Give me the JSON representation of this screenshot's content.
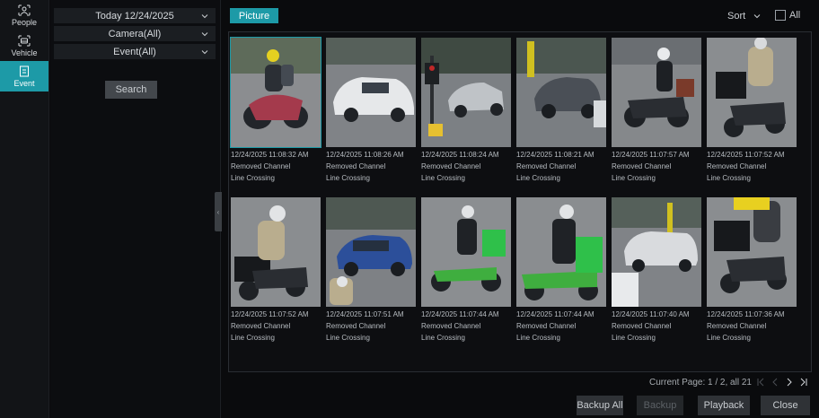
{
  "sidebar": {
    "items": [
      {
        "label": "People",
        "icon": "people-icon"
      },
      {
        "label": "Vehicle",
        "icon": "vehicle-icon"
      },
      {
        "label": "Event",
        "icon": "event-icon"
      }
    ]
  },
  "filters": {
    "date": "Today 12/24/2025",
    "camera": "Camera(All)",
    "event": "Event(All)",
    "search_label": "Search"
  },
  "toolbar": {
    "tab_picture": "Picture",
    "sort_label": "Sort",
    "all_label": "All"
  },
  "results": [
    {
      "time": "12/24/2025 11:08:32 AM",
      "channel": "Removed Channel",
      "event": "Line Crossing"
    },
    {
      "time": "12/24/2025 11:08:26 AM",
      "channel": "Removed Channel",
      "event": "Line Crossing"
    },
    {
      "time": "12/24/2025 11:08:24 AM",
      "channel": "Removed Channel",
      "event": "Line Crossing"
    },
    {
      "time": "12/24/2025 11:08:21 AM",
      "channel": "Removed Channel",
      "event": "Line Crossing"
    },
    {
      "time": "12/24/2025 11:07:57 AM",
      "channel": "Removed Channel",
      "event": "Line Crossing"
    },
    {
      "time": "12/24/2025 11:07:52 AM",
      "channel": "Removed Channel",
      "event": "Line Crossing"
    },
    {
      "time": "12/24/2025 11:07:52 AM",
      "channel": "Removed Channel",
      "event": "Line Crossing"
    },
    {
      "time": "12/24/2025 11:07:51 AM",
      "channel": "Removed Channel",
      "event": "Line Crossing"
    },
    {
      "time": "12/24/2025 11:07:44 AM",
      "channel": "Removed Channel",
      "event": "Line Crossing"
    },
    {
      "time": "12/24/2025 11:07:44 AM",
      "channel": "Removed Channel",
      "event": "Line Crossing"
    },
    {
      "time": "12/24/2025 11:07:40 AM",
      "channel": "Removed Channel",
      "event": "Line Crossing"
    },
    {
      "time": "12/24/2025 11:07:36 AM",
      "channel": "Removed Channel",
      "event": "Line Crossing"
    }
  ],
  "pager": {
    "text": "Current Page: 1 / 2, all 21"
  },
  "actions": {
    "backup_all": "Backup All",
    "backup": "Backup",
    "playback": "Playback",
    "close": "Close"
  },
  "colors": {
    "accent": "#1d9aa7",
    "background": "#0a0b0d"
  }
}
